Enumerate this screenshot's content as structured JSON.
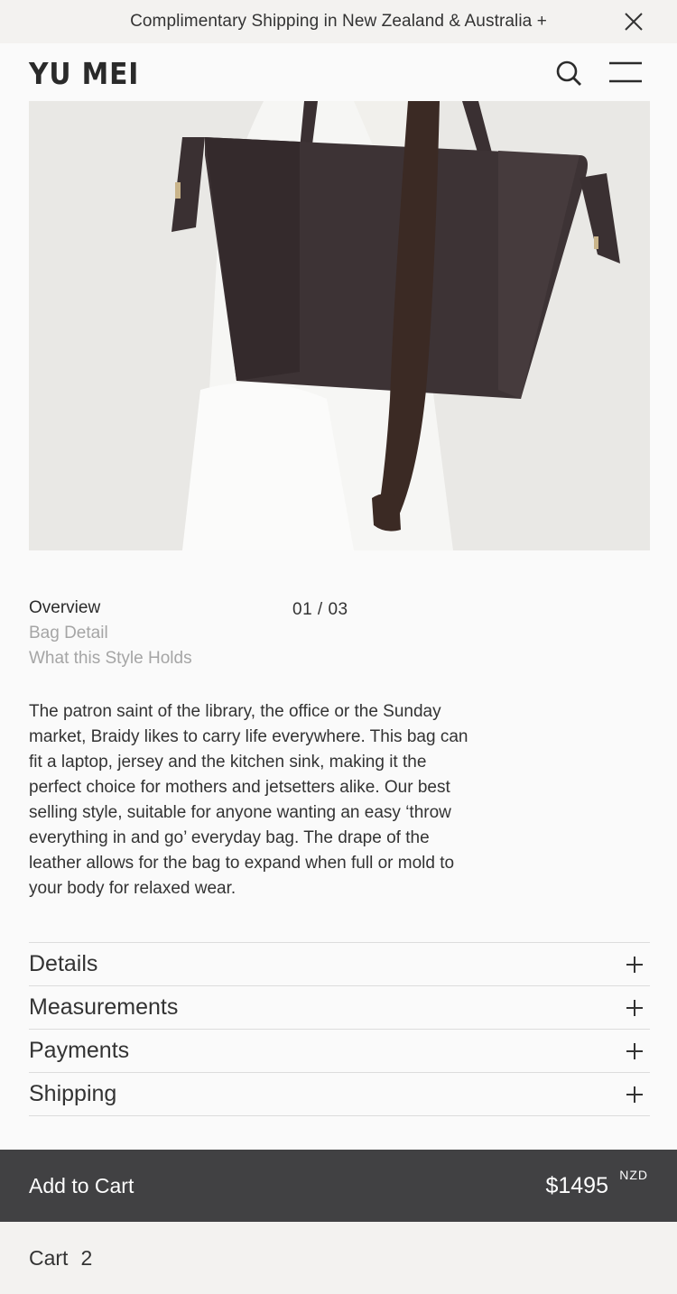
{
  "announcement": {
    "text": "Complimentary Shipping in New Zealand & Australia +"
  },
  "header": {
    "logo": "YU MEI"
  },
  "hero": {
    "icon": "product-photo"
  },
  "tabs": [
    {
      "label": "Overview",
      "active": true
    },
    {
      "label": "Bag Detail",
      "active": false
    },
    {
      "label": "What this Style Holds",
      "active": false
    }
  ],
  "counter": "01 / 03",
  "description": "The patron saint of the library, the office or the Sunday market, Braidy likes to carry life everywhere. This bag can fit a laptop, jersey and the kitchen sink, making it the perfect choice for mothers and jetsetters alike. Our best selling style, suitable for anyone wanting an easy ‘throw everything in and go’ everyday bag. The drape of the leather allows for the bag to expand when full or mold to your body for relaxed wear.",
  "accordion": [
    {
      "label": "Details"
    },
    {
      "label": "Measurements"
    },
    {
      "label": "Payments"
    },
    {
      "label": "Shipping"
    }
  ],
  "add_to_cart": {
    "label": "Add to Cart",
    "price": "$1495",
    "currency": "NZD"
  },
  "cart": {
    "label": "Cart",
    "count": "2"
  },
  "colors": {
    "accent": "#414143",
    "background": "#fafafa",
    "bar": "#f3f2f0"
  }
}
